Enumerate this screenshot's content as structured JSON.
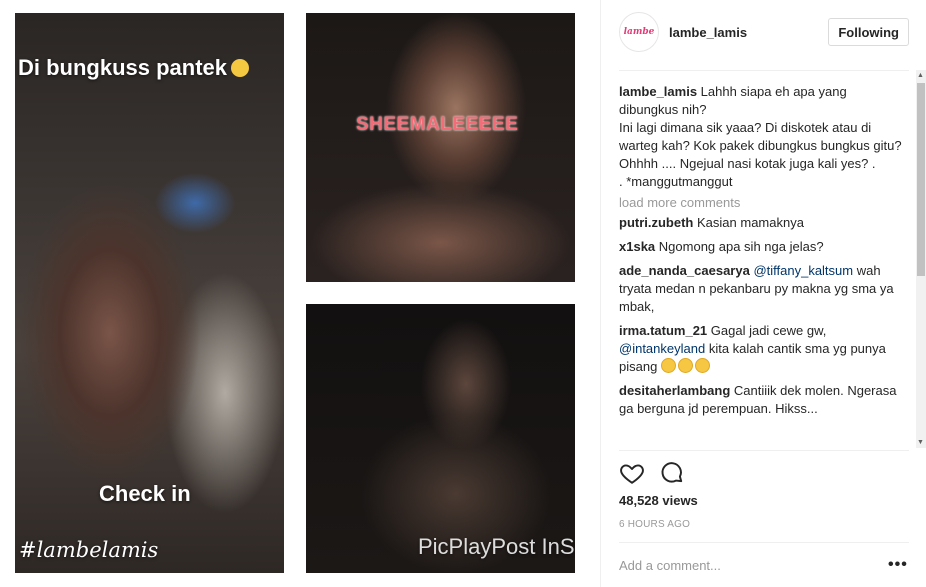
{
  "media": {
    "left_text_top": "Di bungkuss pantek",
    "left_text_checkin": "Check in",
    "left_hashtag": "#lambelamis",
    "top_right_text": "SHEEMALEEEEE",
    "bottom_right_watermark": "PicPlayPost InShOt"
  },
  "post": {
    "username": "lambe_lamis",
    "follow_label": "Following",
    "caption_user": "lambe_lamis",
    "caption_text": "Lahhh siapa eh apa yang dibungkus nih?\nIni lagi dimana sik yaaa? Di diskotek atau di warteg kah? Kok pakek dibungkus bungkus gitu? Ohhhh .... Ngejual nasi kotak juga kali yes? .\n. *manggutmanggut",
    "load_more": "load more comments",
    "comments": [
      {
        "user": "putri.zubeth",
        "text": "Kasian mamaknya"
      },
      {
        "user": "x1ska",
        "text": "Ngomong apa sih nga jelas?"
      },
      {
        "user": "ade_nanda_caesarya",
        "mention": "@tiffany_kaltsum",
        "text": "wah tryata medan n pekanbaru py makna yg sma ya mbak,"
      },
      {
        "user": "irma.tatum_21",
        "text": "Gagal jadi cewe gw,",
        "mention": "@intankeyland",
        "text2": "kita kalah cantik sma yg punya pisang"
      },
      {
        "user": "desitaherlambang",
        "text": "Cantiiik dek molen. Ngerasa ga berguna jd perempuan. Hikss..."
      }
    ],
    "views": "48,528 views",
    "time": "6 HOURS AGO",
    "add_comment_placeholder": "Add a comment...",
    "more_label": "•••"
  },
  "icons": {
    "like": "heart-icon",
    "comment": "speech-bubble-icon",
    "more": "more-options-icon"
  },
  "colors": {
    "mention": "#003569",
    "muted": "#999999",
    "border": "#dbdbdb"
  }
}
